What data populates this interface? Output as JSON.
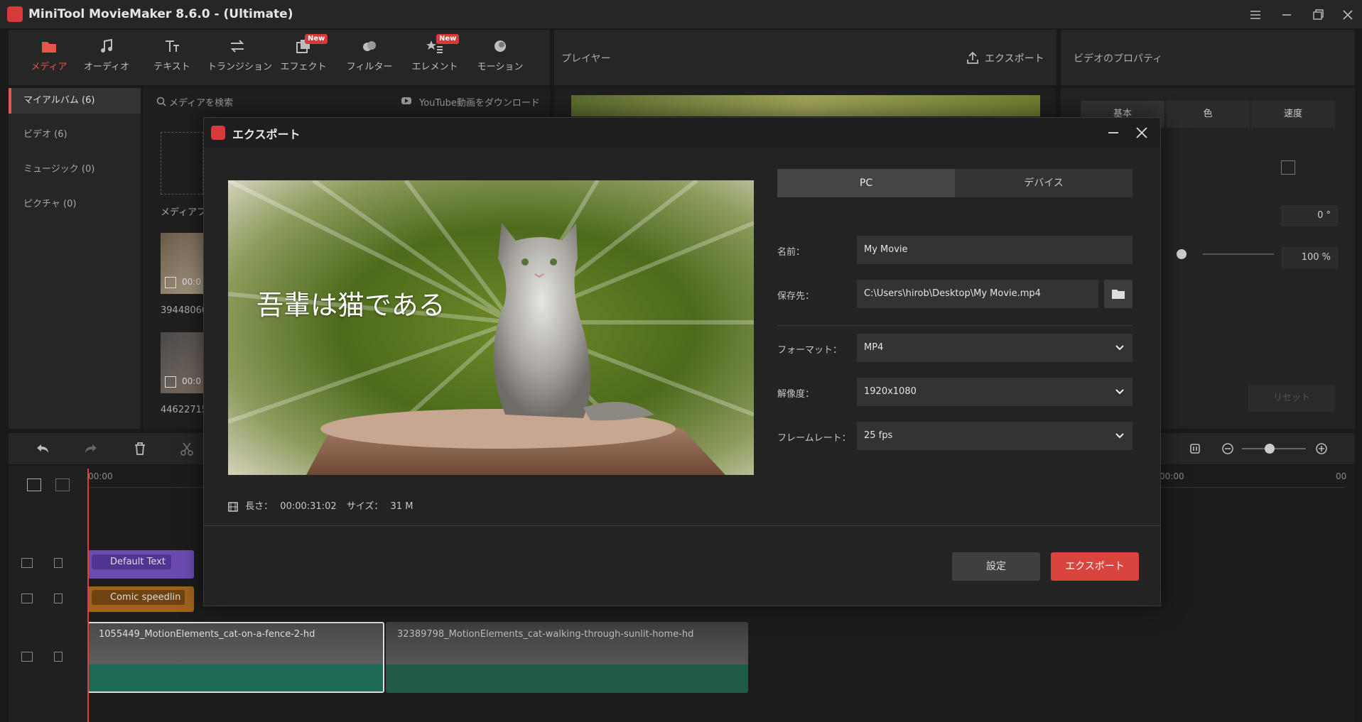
{
  "app": {
    "title": "MiniTool MovieMaker 8.6.0 - (Ultimate)"
  },
  "toolbar": {
    "items": [
      {
        "label": "メディア",
        "icon": "folder-icon"
      },
      {
        "label": "オーディオ",
        "icon": "music-note-icon"
      },
      {
        "label": "テキスト",
        "icon": "text-icon"
      },
      {
        "label": "トランジション",
        "icon": "transition-icon"
      },
      {
        "label": "エフェクト",
        "icon": "effect-icon",
        "badge": "New"
      },
      {
        "label": "フィルター",
        "icon": "filter-icon"
      },
      {
        "label": "エレメント",
        "icon": "element-icon",
        "badge": "New"
      },
      {
        "label": "モーション",
        "icon": "motion-icon"
      }
    ]
  },
  "player": {
    "title": "プレイヤー",
    "export_label": "エクスポート"
  },
  "properties": {
    "title": "ビデオのプロパティ",
    "tabs": [
      "基本",
      "色",
      "速度"
    ],
    "rotation": "0 °",
    "scale": "100 %",
    "reset": "リセット"
  },
  "album": {
    "items": [
      "マイアルバム (6)",
      "ビデオ (6)",
      "ミュージック (0)",
      "ピクチャ (0)"
    ]
  },
  "media": {
    "search_placeholder": "メディアを検索",
    "youtube_label": "YouTube動画をダウンロード",
    "import_label": "メディアフ",
    "thumbs": [
      {
        "name": "39448060",
        "time": "00:0"
      },
      {
        "name": "44622715",
        "time": "00:0"
      }
    ]
  },
  "timeline": {
    "ruler_start": "00:00",
    "ruler_right_a": "00:00",
    "ruler_right_b": "00",
    "tracks": {
      "text_clip": "Default Text",
      "effect_clip": "Comic speedlin",
      "video_clip_1": "1055449_MotionElements_cat-on-a-fence-2-hd",
      "video_clip_2": "32389798_MotionElements_cat-walking-through-sunlit-home-hd"
    }
  },
  "dialog": {
    "title": "エクスポート",
    "preview_caption": "吾輩は猫である",
    "length_label": "長さ：",
    "length_value": "00:00:31:02",
    "size_label": "サイズ：",
    "size_value": "31 M",
    "tabs": {
      "pc": "PC",
      "device": "デバイス"
    },
    "fields": {
      "name_label": "名前：",
      "name_value": "My Movie",
      "save_label": "保存先：",
      "save_value": "C:\\Users\\hirob\\Desktop\\My Movie.mp4",
      "format_label": "フォーマット：",
      "format_value": "MP4",
      "resolution_label": "解像度：",
      "resolution_value": "1920x1080",
      "framerate_label": "フレームレート：",
      "framerate_value": "25 fps"
    },
    "settings_button": "設定",
    "export_button": "エクスポート"
  },
  "colors": {
    "accent": "#d9443f",
    "panel": "#262626",
    "dialog": "#232323"
  }
}
